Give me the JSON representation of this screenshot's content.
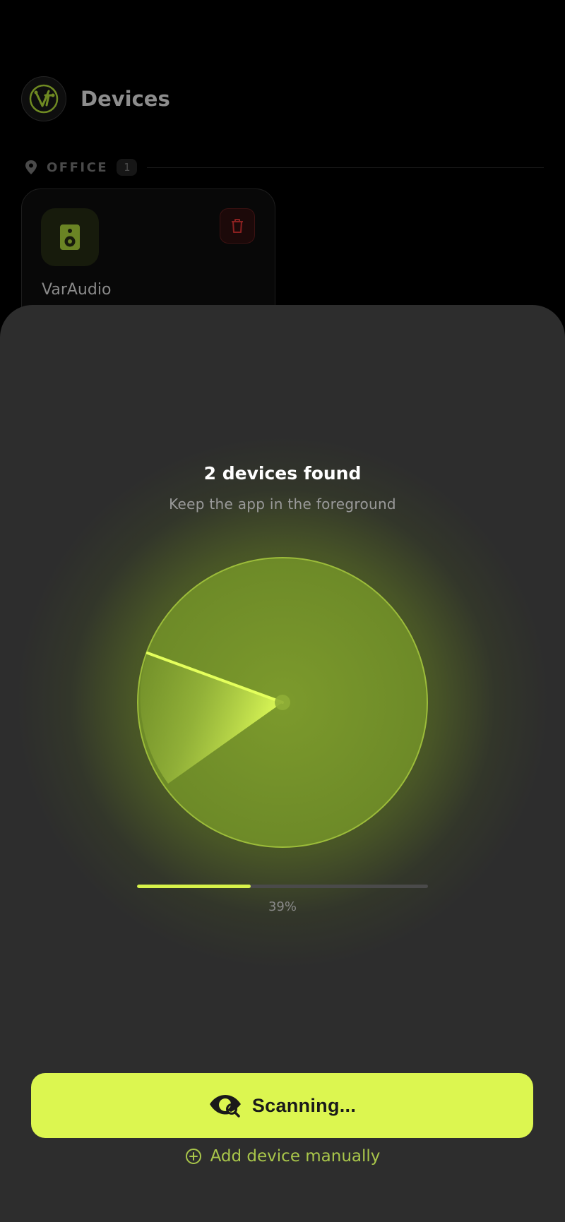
{
  "header": {
    "title": "Devices",
    "logo_icon": "vt-logo-icon"
  },
  "group": {
    "name": "OFFICE",
    "count": "1",
    "icon": "location-pin-icon"
  },
  "device_card": {
    "name": "VarAudio",
    "icon": "speaker-icon",
    "action_icon": "trash-icon"
  },
  "scan_sheet": {
    "title": "2 devices found",
    "subtitle": "Keep the app in the foreground",
    "progress": 0.39,
    "progress_label": "39%",
    "scan_button_label": "Scanning...",
    "scan_button_icon": "eye-search-icon",
    "add_manual_label": "Add device manually",
    "add_manual_icon": "plus-circle-icon"
  },
  "colors": {
    "accent": "#dcf650",
    "background": "#000000",
    "sheet": "#2d2d2d",
    "radar_green": "#7a9a2e",
    "danger": "#b3261e",
    "link_green": "#a9c64a"
  }
}
